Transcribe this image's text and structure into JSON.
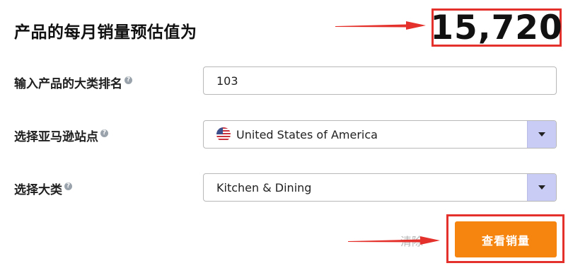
{
  "header": {
    "title": "产品的每月销量预估值为",
    "result_value": "15,720"
  },
  "form": {
    "rank": {
      "label": "输入产品的大类排名",
      "value": "103"
    },
    "site": {
      "label": "选择亚马逊站点",
      "value": "United States of America",
      "flag_icon": "us-flag-icon"
    },
    "category": {
      "label": "选择大类",
      "value": "Kitchen & Dining"
    },
    "help_glyph": "?"
  },
  "actions": {
    "clear_label": "清除",
    "submit_label": "查看销量"
  },
  "colors": {
    "accent": "#f5850f",
    "annotation_red": "#e4312b",
    "select_arrow_bg": "#c9ccf5"
  }
}
